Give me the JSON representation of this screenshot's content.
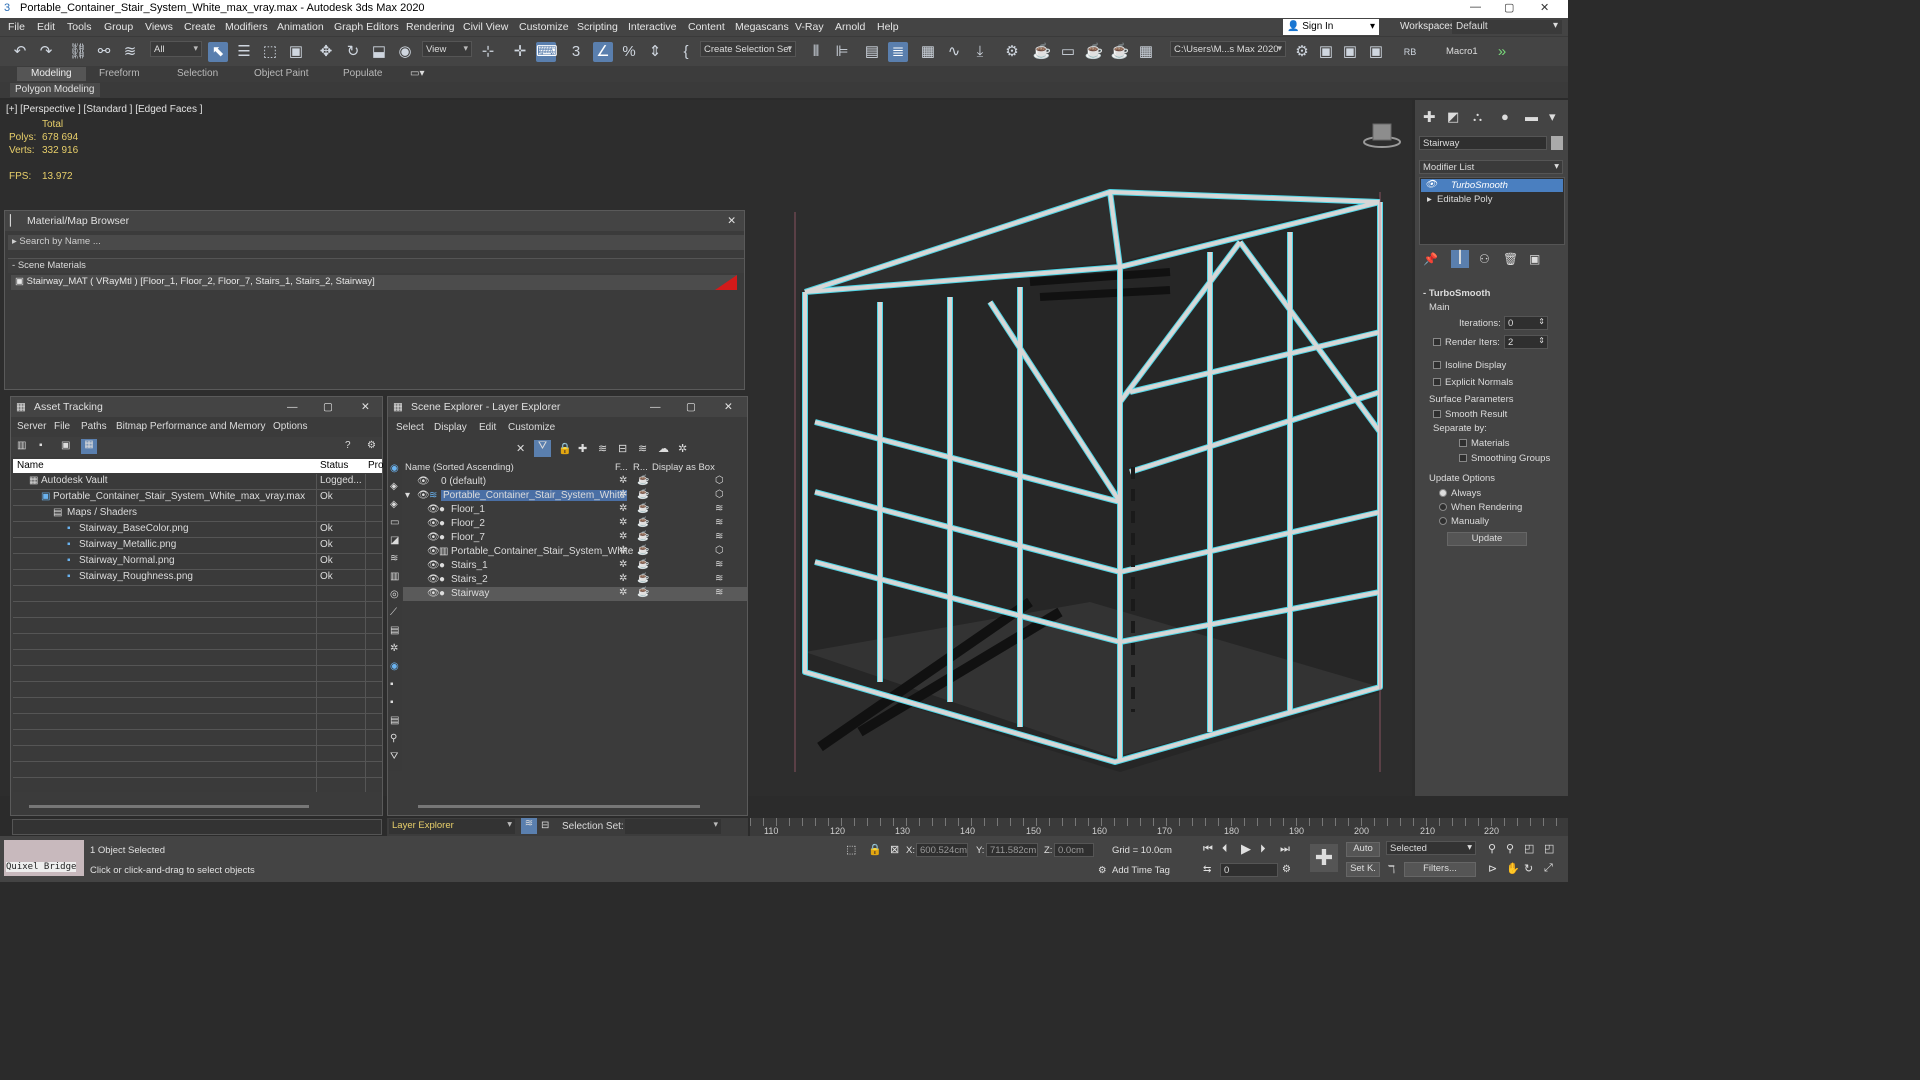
{
  "window": {
    "title": "Portable_Container_Stair_System_White_max_vray.max - Autodesk 3ds Max 2020"
  },
  "menu": [
    "File",
    "Edit",
    "Tools",
    "Group",
    "Views",
    "Create",
    "Modifiers",
    "Animation",
    "Graph Editors",
    "Rendering",
    "Civil View",
    "Customize",
    "Scripting",
    "Interactive",
    "Content",
    "Megascans",
    "V-Ray",
    "Arnold",
    "Help"
  ],
  "account": {
    "sign_in": "Sign In",
    "workspaces_label": "Workspaces:",
    "workspace": "Default"
  },
  "toolbar": {
    "filter": "All",
    "refcoord": "View",
    "selection_set": "Create Selection Set",
    "project_path": "C:\\Users\\M...s Max 2020",
    "macro": "Macro1",
    "snap_label": "3",
    "percent": "%"
  },
  "ribbon": {
    "tabs": [
      "Modeling",
      "Freeform",
      "Selection",
      "Object Paint",
      "Populate"
    ],
    "active": "Modeling",
    "sub": "Polygon Modeling"
  },
  "viewport": {
    "label": "[+] [Perspective ] [Standard ] [Edged Faces ]",
    "stats_total": "Total",
    "polys_label": "Polys:",
    "polys": "678 694",
    "verts_label": "Verts:",
    "verts": "332 916",
    "fps_label": "FPS:",
    "fps": "13.972",
    "colors": {
      "wire": "#4fd6e6",
      "mesh": "#d7d7d7"
    }
  },
  "material_browser": {
    "title": "Material/Map Browser",
    "search_placeholder": "Search by Name ...",
    "section": "Scene Materials",
    "item": "Stairway_MAT  ( VRayMtl )  [Floor_1, Floor_2, Floor_7, Stairs_1, Stairs_2, Stairway]"
  },
  "asset_tracking": {
    "title": "Asset Tracking",
    "menu": [
      "Server",
      "File",
      "Paths",
      "Bitmap Performance and Memory",
      "Options"
    ],
    "columns": [
      "Name",
      "Status",
      "Pro"
    ],
    "rows": [
      {
        "name": "Autodesk Vault",
        "status": "Logged..."
      },
      {
        "name": "Portable_Container_Stair_System_White_max_vray.max",
        "status": "Ok"
      },
      {
        "name": "Maps / Shaders",
        "status": ""
      },
      {
        "name": "Stairway_BaseColor.png",
        "status": "Ok"
      },
      {
        "name": "Stairway_Metallic.png",
        "status": "Ok"
      },
      {
        "name": "Stairway_Normal.png",
        "status": "Ok"
      },
      {
        "name": "Stairway_Roughness.png",
        "status": "Ok"
      }
    ]
  },
  "scene_explorer": {
    "title": "Scene Explorer - Layer Explorer",
    "menu": [
      "Select",
      "Display",
      "Edit",
      "Customize"
    ],
    "columns": [
      "Name (Sorted Ascending)",
      "F...",
      "R...",
      "Display as Box"
    ],
    "rows": [
      "0 (default)",
      "Portable_Container_Stair_System_White",
      "Floor_1",
      "Floor_2",
      "Floor_7",
      "Portable_Container_Stair_System_White",
      "Stairs_1",
      "Stairs_2",
      "Stairway"
    ],
    "footer_dropdown": "Layer Explorer",
    "selection_set_label": "Selection Set:"
  },
  "command_panel": {
    "object_name": "Stairway",
    "modifier_list": "Modifier List",
    "stack": [
      "TurboSmooth",
      "Editable Poly"
    ],
    "rollout": "TurboSmooth",
    "main": "Main",
    "iterations_label": "Iterations:",
    "iterations": "0",
    "render_iters_label": "Render Iters:",
    "render_iters": "2",
    "isoline": "Isoline Display",
    "explicit": "Explicit Normals",
    "surface_params": "Surface Parameters",
    "smooth_result": "Smooth Result",
    "separate_by": "Separate by:",
    "materials": "Materials",
    "smoothing_groups": "Smoothing Groups",
    "update_options": "Update Options",
    "always": "Always",
    "when_rendering": "When Rendering",
    "manually": "Manually",
    "update_btn": "Update"
  },
  "timeline": {
    "ticks": [
      "110",
      "120",
      "130",
      "140",
      "150",
      "160",
      "170",
      "180",
      "190",
      "200",
      "210",
      "220"
    ]
  },
  "status": {
    "quixel": "Quixel Bridge",
    "selected": "1 Object Selected",
    "hint": "Click or click-and-drag to select objects",
    "x_label": "X:",
    "x": "600.524cm",
    "y_label": "Y:",
    "y": "711.582cm",
    "z_label": "Z:",
    "z": "0.0cm",
    "grid": "Grid = 10.0cm",
    "add_time_tag": "Add Time Tag",
    "auto": "Auto",
    "set_k": "Set K.",
    "key_filter": "Selected",
    "filters": "Filters...",
    "frame": "0"
  }
}
